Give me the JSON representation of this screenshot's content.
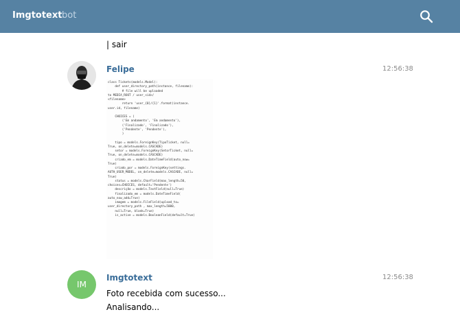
{
  "header": {
    "title": "Imgtotext",
    "subtitle": "bot"
  },
  "messages": {
    "partial_line": "| sair",
    "felipe": {
      "name": "Felipe",
      "time": "12:56:38",
      "code_lines": [
        "class Tickets(models.Model):",
        "    def user_directory_path(instance, filename):",
        "        # file will be uploaded",
        "to MEDIA_ROOT / user_<id>/",
        "<filename>",
        "        return 'user_{0}/{1}'.format(instance.",
        "user.id, filename)",
        "",
        "    CHOICES = (",
        "        ('Em andamento', 'Em andamento'),",
        "        ('Finalizado', 'Finalizado'),",
        "        ('Pendente', 'Pendente'),",
        "        )",
        "",
        "    tipo = models.ForeignKey(TipoTicket, null=",
        "True, on_delete=models.CASCADE)",
        "    setor = models.ForeignKey(SetorTicket, null=",
        "True, on_delete=models.CASCADE)",
        "    criado_em = models.DateTimeField(auto_now=",
        "True)",
        "    criado_por = models.ForeignKey(settings.",
        "AUTH_USER_MODEL, on_delete=models.CASCADE, null=",
        "True)",
        "    status = models.CharField(max_length=50,",
        "choices=CHOICES, default='Pendente')",
        "    descrição = models.TextField(null=True)",
        "    finalizado_em = models.DateTimeField(",
        "auto_now_add=True)",
        "    imagem = models.FileField(upload_to=",
        "user_directory_path , max_length=5000,",
        "    null=True, blank=True)",
        "    is_active = models.BooleanField(default=True)"
      ]
    },
    "bot": {
      "avatar_initials": "IM",
      "name": "Imgtotext",
      "time": "12:56:38",
      "line1": "Foto recebida com sucesso...",
      "line2": "Analisando..."
    }
  },
  "colors": {
    "header_bg": "#5682a3",
    "name_color": "#3a6d99",
    "bot_avatar": "#76c76c"
  },
  "icons": {
    "search": "search-icon"
  }
}
